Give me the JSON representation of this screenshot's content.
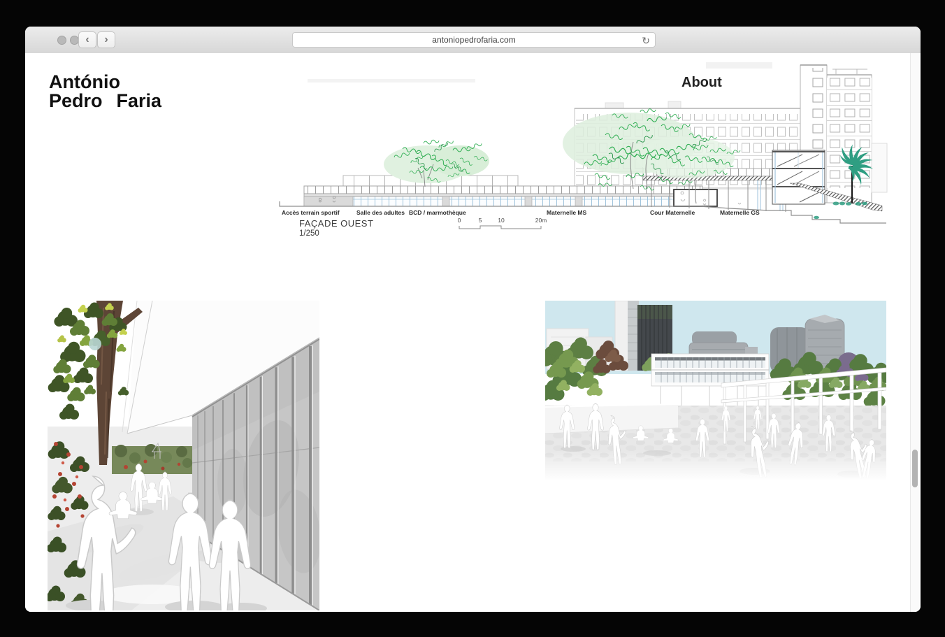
{
  "browser": {
    "url": "antoniopedrofaria.com",
    "back_icon": "‹",
    "forward_icon": "›",
    "reload_icon": "↻"
  },
  "header": {
    "logo_line1": "António",
    "logo_line2_word1": "Pedro",
    "logo_line2_word2": "Faria",
    "about_label": "About"
  },
  "facade_drawing": {
    "title": "FAÇADE OUEST",
    "scale": "1/250",
    "labels": [
      "Accès terrain sportif",
      "Salle des adultes",
      "BCD / marmothèque",
      "Maternelle MS",
      "Cour Maternelle",
      "Maternelle GS"
    ],
    "scale_bar_ticks": [
      "0",
      "5",
      "10",
      "20m"
    ],
    "colors": {
      "foliage_green": "#2fae52",
      "palm_teal": "#2f9e82",
      "glass_blue": "#9fc3dc",
      "panel_grey": "#dadada"
    }
  }
}
